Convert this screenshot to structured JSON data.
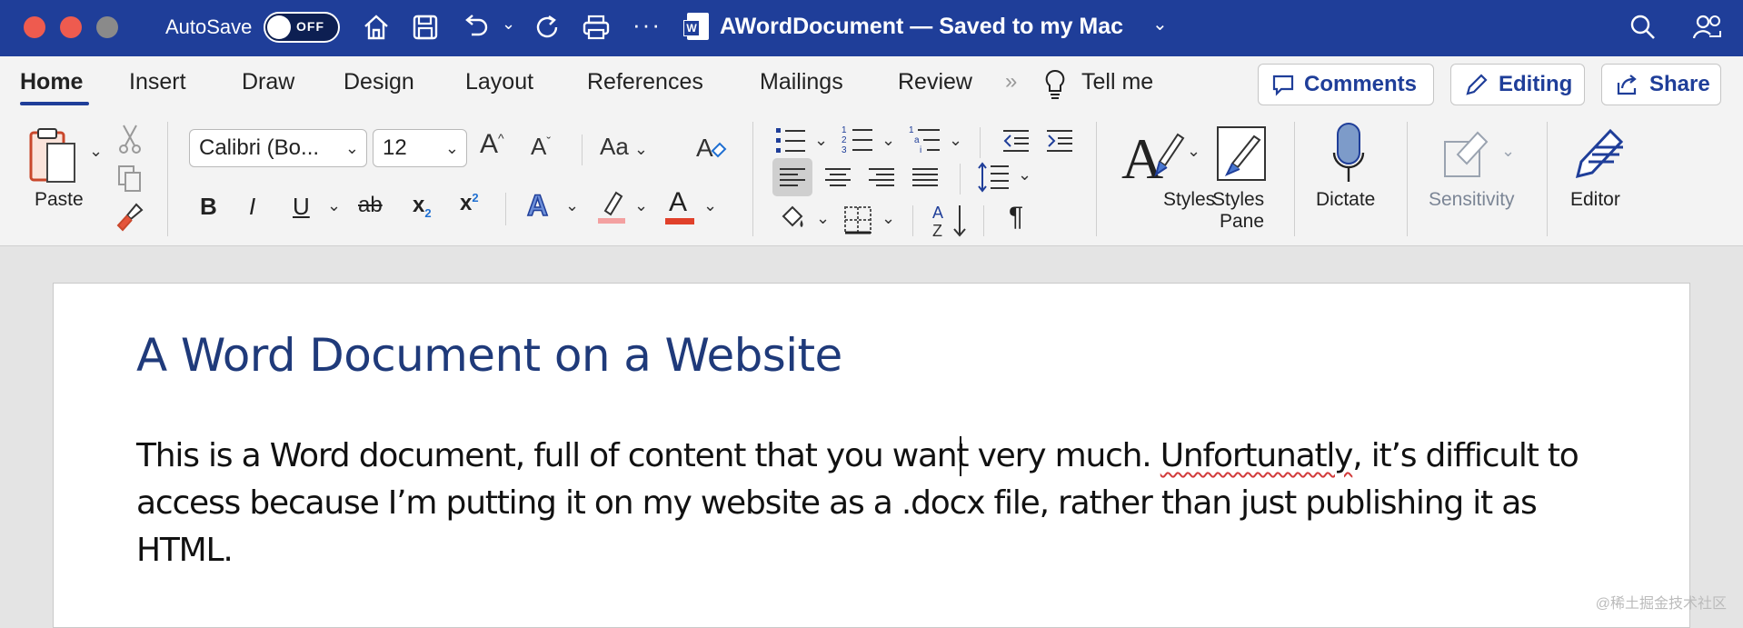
{
  "titlebar": {
    "autosave_label": "AutoSave",
    "autosave_state": "OFF",
    "document_title": "AWordDocument — Saved to my Mac",
    "more_icon": "ellipsis-icon"
  },
  "tabs": [
    "Home",
    "Insert",
    "Draw",
    "Design",
    "Layout",
    "References",
    "Mailings",
    "Review"
  ],
  "active_tab": "Home",
  "tell_me": "Tell me",
  "ribbon_buttons": {
    "comments": "Comments",
    "editing": "Editing",
    "share": "Share"
  },
  "clipboard": {
    "paste": "Paste"
  },
  "font": {
    "family": "Calibri (Bo...",
    "size": "12"
  },
  "formatting": {
    "bold": "B",
    "italic": "I",
    "underline": "U",
    "strike": "ab",
    "subscript": "x",
    "subscript_sub": "2",
    "superscript": "x",
    "superscript_sup": "2",
    "change_case": "Aa",
    "grow": "A",
    "shrink": "A",
    "text_effects": "A",
    "font_color": "A",
    "pilcrow": "¶"
  },
  "groups": {
    "styles": "Styles",
    "styles_pane": [
      "Styles",
      "Pane"
    ],
    "dictate": "Dictate",
    "sensitivity": "Sensitivity",
    "editor": "Editor"
  },
  "document": {
    "title": "A Word Document on a Website",
    "body_lines": [
      "This is a Word document, full of content that you want very much. ",
      "access because I’m putting it on my website as a .docx file, rather than just publishing it as",
      "HTML."
    ],
    "misspelled": "Unfortunatly",
    "line1_tail": ", it’s difficult to"
  },
  "watermark": "@稀土掘金技术社区",
  "colors": {
    "titlebar": "#1f3e99",
    "accent": "#1f3e99",
    "heading": "#1f3a7a",
    "highlight": "#f3a0a0",
    "font_color_bar": "#e0402a"
  }
}
